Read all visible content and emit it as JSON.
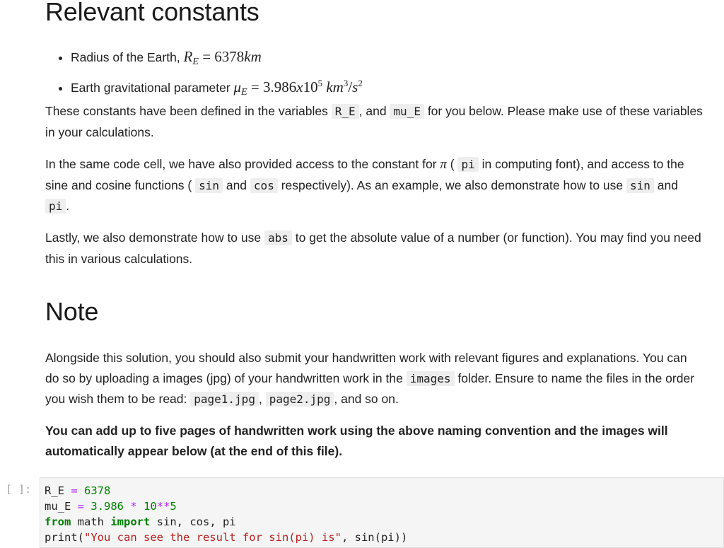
{
  "section1": {
    "title": "Relevant constants",
    "bullets": [
      {
        "label": "Radius of the Earth, ",
        "sym": "R",
        "sub": "E",
        "eq": " = ",
        "value": "6378",
        "unit": "km"
      },
      {
        "label": "Earth gravitational parameter ",
        "sym": "μ",
        "sub": "E",
        "eq": " = ",
        "value": "3.986",
        "x": "x",
        "base": "10",
        "exp": "5",
        "unit1": "km",
        "unit1_exp": "3",
        "slash": "/",
        "unit2": "s",
        "unit2_exp": "2"
      }
    ],
    "para1": {
      "t1": "These constants have been defined in the variables ",
      "c1": "R_E",
      "t2": ", and ",
      "c2": "mu_E",
      "t3": " for you below. Please make use of these variables in your calculations."
    },
    "para2": {
      "t1": "In the same code cell, we have also provided access to the constant for ",
      "pi_sym": "π",
      "t2": " ( ",
      "c1": "pi",
      "t3": " in computing font), and access to the sine and cosine functions ( ",
      "c2": "sin",
      "t4": " and ",
      "c3": "cos",
      "t5": " respectively). As an example, we also demonstrate how to use ",
      "c4": "sin",
      "t6": " and ",
      "c5": "pi",
      "t7": "."
    },
    "para3": {
      "t1": "Lastly, we also demonstrate how to use ",
      "c1": "abs",
      "t2": " to get the absolute value of a number (or function). You may find you need this in various calculations."
    }
  },
  "section2": {
    "title": "Note",
    "para1": {
      "t1": "Alongside this solution, you should also submit your handwritten work with relevant figures and explanations. You can do so by uploading a images (jpg) of your handwritten work in the ",
      "c1": "images",
      "t2": " folder. Ensure to name the files in the order you wish them to be read: ",
      "c2": "page1.jpg",
      "t3": ", ",
      "c3": "page2.jpg",
      "t4": ", and so on."
    },
    "bold_para": "You can add up to five pages of handwritten work using the above naming convention and the images will automatically appear below (at the end of this file)."
  },
  "code_cell": {
    "prompt": "[ ]:",
    "lines": [
      {
        "a": "R_E ",
        "op": "=",
        "b": " ",
        "num": "6378"
      },
      {
        "a": "mu_E ",
        "op": "=",
        "b": " ",
        "num": "3.986",
        "c": " ",
        "op2": "*",
        "d": " ",
        "num2": "10",
        "op3": "**",
        "num3": "5"
      },
      {
        "kw1": "from",
        "a": " math ",
        "kw2": "import",
        "b": " sin, cos, pi"
      },
      {
        "fn": "print(",
        "str": "\"You can see the result for sin(pi) is\"",
        "rest": ", sin(pi))"
      }
    ]
  }
}
